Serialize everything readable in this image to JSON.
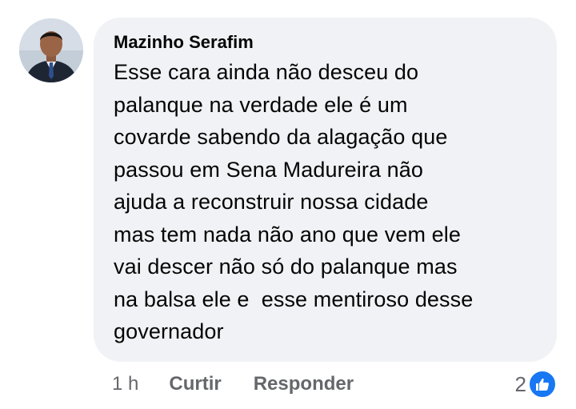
{
  "comment": {
    "author": "Mazinho Serafim",
    "lines": [
      "Esse cara ainda não desceu do",
      "palanque na verdade ele é um",
      "covarde sabendo da alagação que",
      "passou em Sena Madureira não",
      "ajuda a reconstruir nossa cidade",
      "mas tem nada não ano que vem ele",
      "vai descer não só do palanque mas",
      "na balsa ele e  esse mentiroso desse",
      "governador"
    ],
    "timestamp": "1 h",
    "like_label": "Curtir",
    "reply_label": "Responder",
    "reaction_count": "2",
    "reaction_icon": "like-icon",
    "reaction_color": "#1877f2"
  }
}
